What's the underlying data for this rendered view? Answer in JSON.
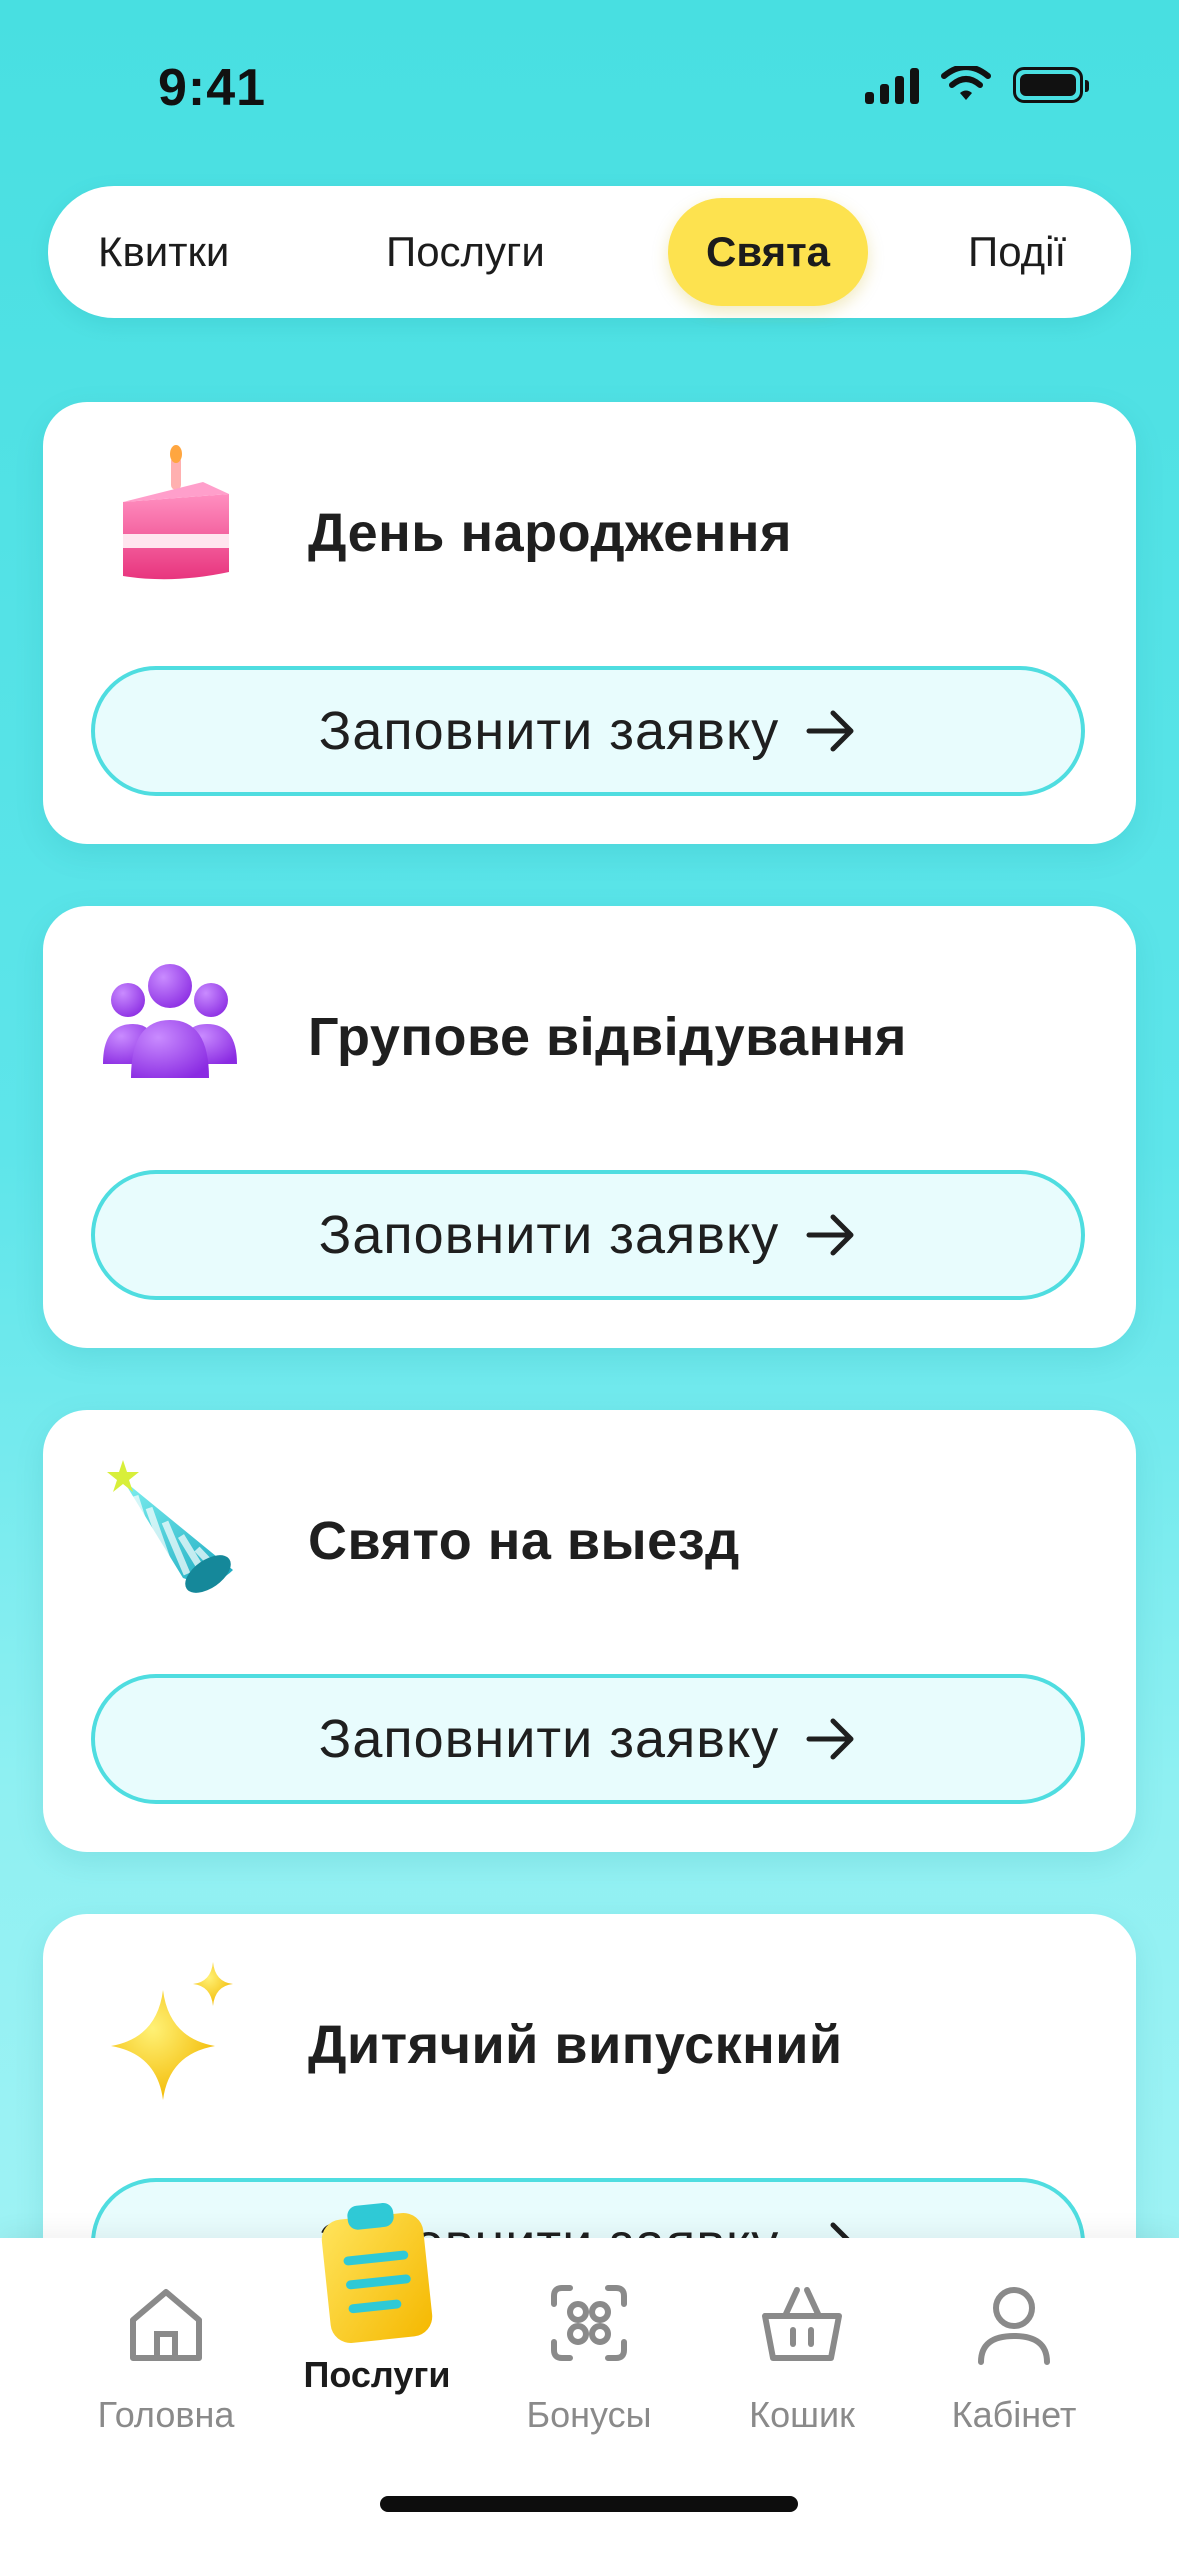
{
  "status_bar": {
    "time": "9:41"
  },
  "top_tabs": [
    {
      "label": "Квитки",
      "active": false
    },
    {
      "label": "Послуги",
      "active": false
    },
    {
      "label": "Свята",
      "active": true
    },
    {
      "label": "Події",
      "active": false
    }
  ],
  "cards": [
    {
      "title": "День народження",
      "button": "Заповнити заявку",
      "icon": "cake-icon"
    },
    {
      "title": "Групове відвідування",
      "button": "Заповнити заявку",
      "icon": "group-people-icon"
    },
    {
      "title": "Свято на выезд",
      "button": "Заповнити заявку",
      "icon": "party-hat-icon"
    },
    {
      "title": "Дитячий випускний",
      "button": "Заповнити заявку",
      "icon": "sparkle-icon"
    }
  ],
  "bottom_nav": [
    {
      "label": "Головна",
      "icon": "home-icon",
      "active": false
    },
    {
      "label": "Послуги",
      "icon": "clipboard-icon",
      "active": true
    },
    {
      "label": "Бонусы",
      "icon": "bonus-icon",
      "active": false
    },
    {
      "label": "Кошик",
      "icon": "basket-icon",
      "active": false
    },
    {
      "label": "Кабінет",
      "icon": "user-icon",
      "active": false
    }
  ],
  "colors": {
    "accent_yellow": "#fde24f",
    "accent_cyan": "#4fdde0",
    "background": "#48dfe1"
  }
}
